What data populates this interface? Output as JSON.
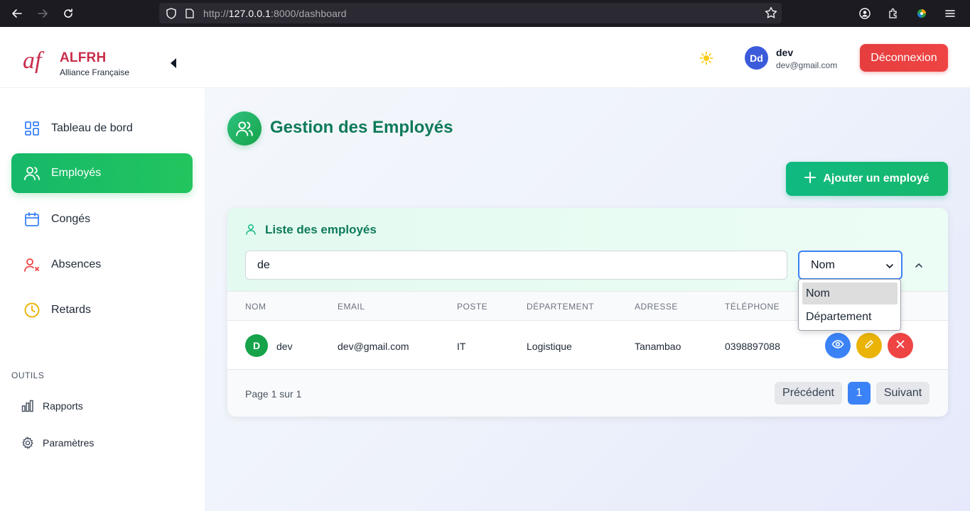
{
  "browser": {
    "url_prefix": "http://",
    "url_host": "127.0.0.1",
    "url_rest": ":8000/dashboard"
  },
  "header": {
    "brand": "ALFRH",
    "brand_sub": "Alliance Française",
    "user_initials": "Dd",
    "user_name": "dev",
    "user_email": "dev@gmail.com",
    "logout_label": "Déconnexion"
  },
  "sidebar": {
    "items": [
      {
        "label": "Tableau de bord",
        "icon": "dashboard-grid-icon"
      },
      {
        "label": "Employés",
        "icon": "users-icon",
        "active": true
      },
      {
        "label": "Congés",
        "icon": "calendar-icon"
      },
      {
        "label": "Absences",
        "icon": "user-x-icon"
      },
      {
        "label": "Retards",
        "icon": "clock-icon"
      }
    ],
    "tools_heading": "OUTILS",
    "tools": [
      {
        "label": "Rapports",
        "icon": "bar-chart-icon"
      },
      {
        "label": "Paramètres",
        "icon": "gear-icon"
      }
    ]
  },
  "main": {
    "page_title": "Gestion des Employés",
    "add_button": "Ajouter un employé",
    "list_title": "Liste des employés",
    "search_value": "de",
    "filter_selected": "Nom",
    "filter_options": [
      "Nom",
      "Département"
    ],
    "columns": [
      "NOM",
      "EMAIL",
      "POSTE",
      "DÉPARTEMENT",
      "ADRESSE",
      "TÉLÉPHONE"
    ],
    "rows": [
      {
        "initial": "D",
        "nom": "dev",
        "email": "dev@gmail.com",
        "poste": "IT",
        "departement": "Logistique",
        "adresse": "Tanambao",
        "telephone": "0398897088"
      }
    ],
    "page_info": "Page 1 sur 1",
    "prev_label": "Précédent",
    "page_number": "1",
    "next_label": "Suivant"
  },
  "colors": {
    "accent_green": "#16b86a",
    "brand_red": "#c82d4b",
    "logout_red": "#ef4444",
    "view_blue": "#3b82f6",
    "edit_yellow": "#eab308",
    "delete_red": "#ef4444"
  }
}
